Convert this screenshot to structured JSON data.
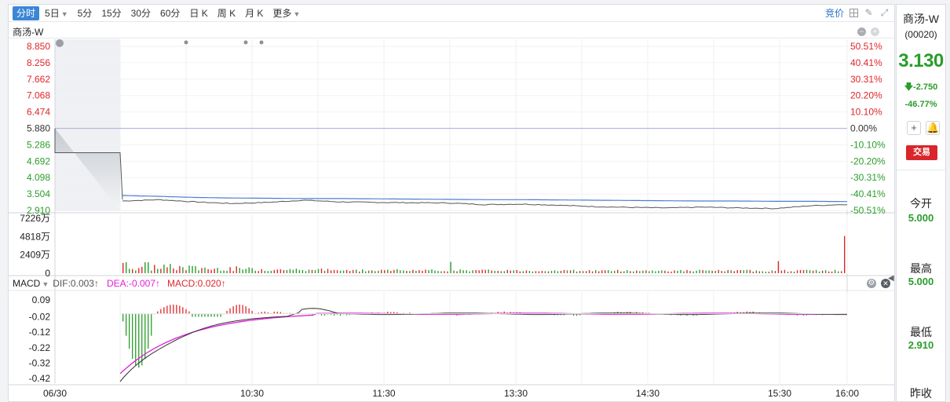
{
  "toolbar": {
    "tabs": [
      "分时",
      "5日",
      "5分",
      "15分",
      "30分",
      "60分",
      "日 K",
      "周 K",
      "月 K",
      "更多"
    ],
    "bid_price": "竞价"
  },
  "stock": {
    "name": "商汤-W",
    "code": "(00020)",
    "price": "3.130",
    "change": "-2.750",
    "change_pct": "-46.77%",
    "trade_label": "交易"
  },
  "stats": [
    {
      "label": "今开",
      "value": "5.000"
    },
    {
      "label": "最高",
      "value": "5.000"
    },
    {
      "label": "最低",
      "value": "2.910"
    },
    {
      "label": "昨收",
      "value": ""
    }
  ],
  "macd": {
    "name": "MACD",
    "dif": "DIF:0.003↑",
    "dea": "DEA:-0.007↑",
    "macd": "MACD:0.020↑"
  },
  "colors": {
    "up": "#e0262a",
    "down": "#2a9d2a",
    "price_line": "#555555",
    "avg_line": "#4a7fd0",
    "dea_line": "#e01ed8",
    "accent": "#3b86d6"
  },
  "chart_data": [
    {
      "type": "line",
      "title": "商汤-W",
      "x": [
        "06/30",
        "10:30",
        "11:30",
        "13:30",
        "14:30",
        "15:30",
        "16:00"
      ],
      "prev_close": 5.88,
      "ylim": [
        2.91,
        8.85
      ],
      "y_ticks": [
        "8.850",
        "8.256",
        "7.662",
        "7.068",
        "6.474",
        "5.880",
        "5.286",
        "4.692",
        "4.098",
        "3.504",
        "2.910"
      ],
      "y_ticks_right": [
        "50.51%",
        "40.41%",
        "30.31%",
        "20.20%",
        "10.10%",
        "0.00%",
        "-10.10%",
        "-20.20%",
        "-30.31%",
        "-40.41%",
        "-50.51%"
      ],
      "series": [
        {
          "values": [
            3.25,
            3.3,
            3.22,
            3.16,
            3.2,
            3.28,
            3.22,
            3.2,
            3.19,
            3.18,
            3.12,
            3.14,
            3.1,
            3.05,
            3.02,
            3.0,
            3.03,
            3.0,
            2.98,
            3.08,
            3.13
          ]
        },
        {
          "values": [
            3.45,
            3.42,
            3.38,
            3.36,
            3.35,
            3.34,
            3.34,
            3.33,
            3.32,
            3.31,
            3.3,
            3.3,
            3.29,
            3.28,
            3.27,
            3.26,
            3.25,
            3.25,
            3.24,
            3.24,
            3.23
          ]
        }
      ]
    },
    {
      "type": "bar",
      "y_ticks": [
        "7226万",
        "4818万",
        "2409万",
        "0"
      ],
      "ylim": [
        0,
        7226
      ]
    },
    {
      "type": "bar",
      "y_ticks": [
        "0.09",
        "-0.02",
        "-0.12",
        "-0.22",
        "-0.32",
        "-0.42"
      ],
      "ylim": [
        -0.45,
        0.1
      ]
    }
  ]
}
